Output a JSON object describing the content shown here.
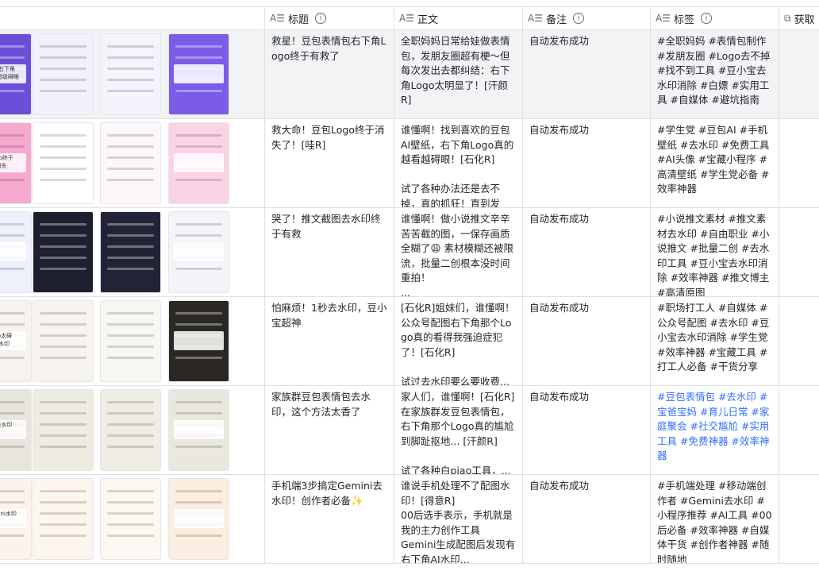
{
  "columns": [
    {
      "label": "标题",
      "icon": "text-field-icon"
    },
    {
      "label": "正文",
      "icon": "text-field-icon"
    },
    {
      "label": "备注",
      "icon": "text-field-icon"
    },
    {
      "label": "标签",
      "icon": "text-field-icon"
    },
    {
      "label": "获取",
      "icon": "lookup-field-icon"
    }
  ],
  "rows": [
    {
      "title": "救星！豆包表情包右下角Logo终于有救了",
      "body": "全职妈妈日常给娃做表情包，发朋友圈超有梗～但每次发出去都纠结：右下角Logo太明显了！[汗颜R]\n\n试过好几种方法，要么...",
      "note": "自动发布成功",
      "tags": "#全职妈妈 #表情包制作 #发朋友圈 #Logo去不掉 #找不到工具 #豆小宝去水印消除 #白嫖 #实用工具 #自媒体 #避坑指南",
      "thumb_text": [
        "的你右下角",
        "Logo超级碍眼"
      ]
    },
    {
      "title": "救大命！豆包Logo终于消失了！[哇R]",
      "body": "谁懂啊！找到喜欢的豆包AI壁纸，右下角Logo真的越看越碍眼！[石化R]\n\n试了各种办法还是去不掉，真的抓狂！直到发现...",
      "note": "自动发布成功",
      "tags": "#学生党 #豆包AI #手机壁纸 #去水印 #免费工具 #AI头像 #宝藏小程序 #高清壁纸 #学生党必备 #效率神器",
      "thumb_text": [
        "Logo终于",
        "消失"
      ]
    },
    {
      "title": "哭了！推文截图去水印终于有救",
      "body": "谁懂啊！做小说推文辛辛苦苦截的图，一保存画质全糊了😩 素材模糊还被限流，批量二创根本没时间重拍！\n...",
      "note": "自动发布成功",
      "tags": "#小说推文素材 #推文素材去水印 #自由职业 #小说推文 #批量二创 #去水印工具 #豆小宝去水印消除 #效率神器 #推文博主 #高清原图",
      "thumb_text": [
        "",
        ""
      ]
    },
    {
      "title": "怕麻烦！1秒去水印，豆小宝超神",
      "body": "[石化R]姐妹们，谁懂啊！公众号配图右下角那个Logo真的看得我强迫症犯了！[石化R]\n\n试过去水印要么要收费...",
      "note": "自动发布成功",
      "tags": "#职场打工人 #自媒体 #公众号配图 #去水印 #豆小宝去水印消除 #学生党 #效率神器 #宝藏工具 #打工人必备 #干货分享",
      "thumb_text": [
        "ogo太碍",
        "去水印"
      ]
    },
    {
      "title": "家族群豆包表情包去水印，这个方法太香了",
      "body": "家人们，谁懂啊！[石化R]在家族群发豆包表情包，右下角那个Logo真的尴尬到脚趾抠地... [汗颜R]\n\n试了各种白piao工具，...",
      "note": "自动发布成功",
      "tags": "#豆包表情包 #去水印 #宝爸宝妈 #育儿日常 #家庭聚会 #社交尴尬 #实用工具 #免费神器 #效率神器",
      "thumb_text": [
        "包去水印",
        ""
      ]
    },
    {
      "title": "手机端3步搞定Gemini去水印！创作者必备✨",
      "body": "谁说手机处理不了配图水印！[得意R]\n00后选手表示，手机就是我的主力创作工具\nGemini生成配图后发现有右下角AI水印...",
      "note": "自动发布成功",
      "tags": "#手机端处理 #移动端创作者 #Gemini去水印 #小程序推荐 #AI工具 #00后必备 #效率神器 #自媒体干货 #创作者神器 #随时随地",
      "thumb_text": [
        "Gemini水印",
        ""
      ]
    }
  ],
  "thumbs": {
    "row1": [
      "#6b4fd8",
      "#f3f0fb",
      "#f5f3fb",
      "#7b5ce6"
    ],
    "row2": [
      "#f7a8cf",
      "#ffffff",
      "#fdf6fa",
      "#fbd3e6"
    ],
    "row3": [
      "#eef1fb",
      "#1e2030",
      "#222436",
      "#f4f5f9"
    ],
    "row4": [
      "#f6f3ee",
      "#f7f4ef",
      "#f8f6f1",
      "#2b2823"
    ],
    "row5": [
      "#e7e5dc",
      "#edebe2",
      "#eeece3",
      "#e9e7de"
    ],
    "row6": [
      "#fdf3ea",
      "#fdf6ef",
      "#fdf7f1",
      "#fbeee0"
    ]
  }
}
